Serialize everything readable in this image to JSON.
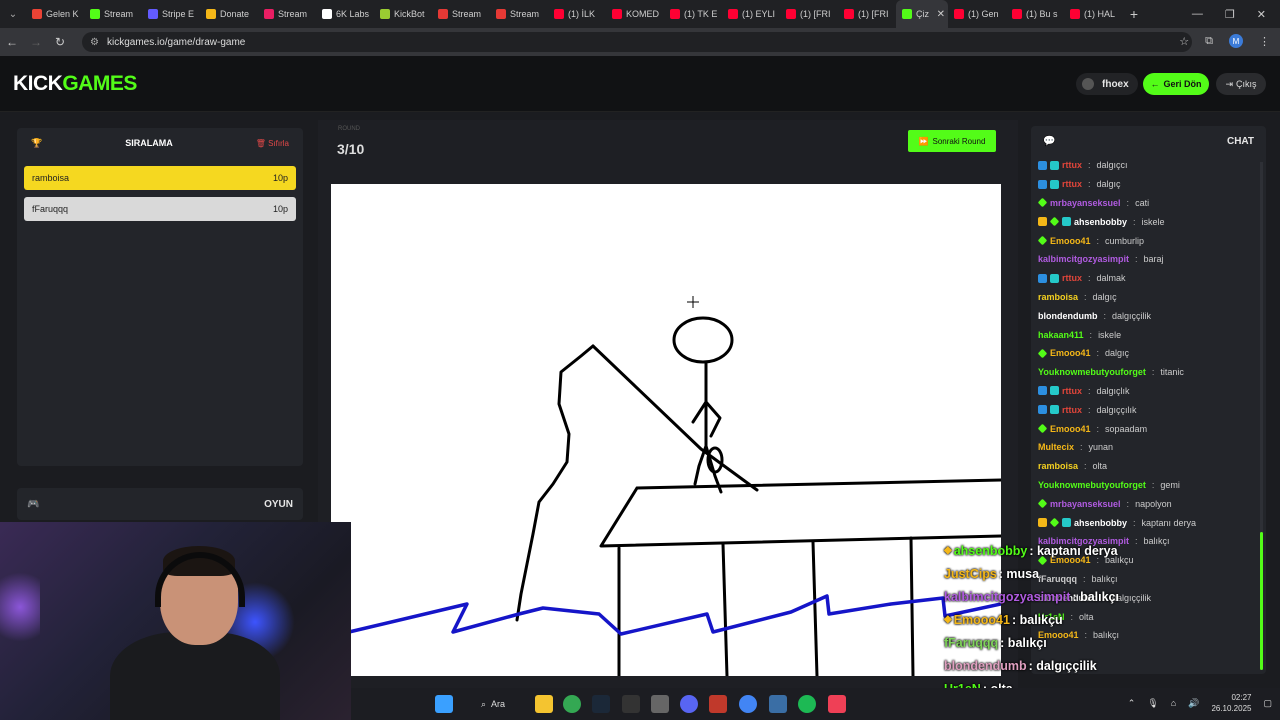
{
  "browser": {
    "tabs": [
      {
        "label": "Gelen K",
        "color": "#ea4335"
      },
      {
        "label": "Stream",
        "color": "#53fc18"
      },
      {
        "label": "Stripe E",
        "color": "#635bff"
      },
      {
        "label": "Donate",
        "color": "#f4b718"
      },
      {
        "label": "Stream",
        "color": "#e91e63"
      },
      {
        "label": "6K Labs",
        "color": "#ffffff"
      },
      {
        "label": "KickBot",
        "color": "#9acd32"
      },
      {
        "label": "Stream",
        "color": "#e53935"
      },
      {
        "label": "Stream",
        "color": "#e53935"
      },
      {
        "label": "(1) İLK",
        "color": "#ff0033"
      },
      {
        "label": "KOMED",
        "color": "#ff0033"
      },
      {
        "label": "(1) TK E",
        "color": "#ff0033"
      },
      {
        "label": "(1) EYLI",
        "color": "#ff0033"
      },
      {
        "label": "(1) [FRI",
        "color": "#ff0033"
      },
      {
        "label": "(1) [FRI",
        "color": "#ff0033"
      },
      {
        "label": "Çiz",
        "color": "#53fc18",
        "active": true
      },
      {
        "label": "(1) Gen",
        "color": "#ff0033"
      },
      {
        "label": "(1) Bu s",
        "color": "#ff0033"
      },
      {
        "label": "(1) HAL",
        "color": "#ff0033"
      }
    ],
    "url": "kickgames.io/game/draw-game",
    "profile_initial": "M"
  },
  "header": {
    "logo_part1": "KICK",
    "logo_part2": "GAMES",
    "username": "fhoex",
    "back_label": "Geri Dön",
    "exit_label": "Çıkış"
  },
  "leaderboard": {
    "title": "SIRALAMA",
    "reset_label": "Sıfırla",
    "rows": [
      {
        "name": "ramboisa",
        "points": "10p",
        "color": "#f5d820"
      },
      {
        "name": "fFaruqqq",
        "points": "10p",
        "color": "#d9d9d9"
      }
    ]
  },
  "game_panel": {
    "title": "OYUN"
  },
  "round": {
    "label": "ROUND",
    "value": "3/10",
    "next_label": "Sonraki Round"
  },
  "chat": {
    "title": "CHAT",
    "messages": [
      {
        "user": "rttux",
        "color": "#e0453a",
        "badges": [
          "blue",
          "teal"
        ],
        "text": "dalgıçcı"
      },
      {
        "user": "rttux",
        "color": "#e0453a",
        "badges": [
          "blue",
          "teal"
        ],
        "text": "dalgıç"
      },
      {
        "user": "mrbayanseksuel",
        "color": "#b05be0",
        "badges": [
          "green"
        ],
        "text": "cati"
      },
      {
        "user": "ahsenbobby",
        "color": "#ffffff",
        "badges": [
          "gold",
          "green",
          "teal"
        ],
        "text": "iskele"
      },
      {
        "user": "Emooo41",
        "color": "#f4b718",
        "badges": [
          "green"
        ],
        "text": "cumburlip"
      },
      {
        "user": "kalbimcitgozyasimpit",
        "color": "#b05be0",
        "badges": [],
        "text": "baraj"
      },
      {
        "user": "rttux",
        "color": "#e0453a",
        "badges": [
          "blue",
          "teal"
        ],
        "text": "dalmak"
      },
      {
        "user": "ramboisa",
        "color": "#f4d020",
        "badges": [],
        "text": "dalgıç"
      },
      {
        "user": "blondendumb",
        "color": "#ffffff",
        "badges": [],
        "text": "dalgıççilik"
      },
      {
        "user": "hakaan411",
        "color": "#53fc18",
        "badges": [],
        "text": "iskele"
      },
      {
        "user": "Emooo41",
        "color": "#f4b718",
        "badges": [
          "green"
        ],
        "text": "dalgıç"
      },
      {
        "user": "Youknowmebutyouforget",
        "color": "#53fc18",
        "badges": [],
        "text": "titanic"
      },
      {
        "user": "rttux",
        "color": "#e0453a",
        "badges": [
          "blue",
          "teal"
        ],
        "text": "dalgıçlık"
      },
      {
        "user": "rttux",
        "color": "#e0453a",
        "badges": [
          "blue",
          "teal"
        ],
        "text": "dalgıççılık"
      },
      {
        "user": "Emooo41",
        "color": "#f4b718",
        "badges": [
          "green"
        ],
        "text": "sopaadam"
      },
      {
        "user": "Multecix",
        "color": "#f4b718",
        "badges": [],
        "text": "yunan"
      },
      {
        "user": "ramboisa",
        "color": "#f4d020",
        "badges": [],
        "text": "olta"
      },
      {
        "user": "Youknowmebutyouforget",
        "color": "#53fc18",
        "badges": [],
        "text": "gemi"
      },
      {
        "user": "mrbayanseksuel",
        "color": "#b05be0",
        "badges": [
          "green"
        ],
        "text": "napolyon"
      },
      {
        "user": "ahsenbobby",
        "color": "#ffffff",
        "badges": [
          "gold",
          "green",
          "teal"
        ],
        "text": "kaptanı derya"
      },
      {
        "user": "kalbimcitgozyasimpit",
        "color": "#b05be0",
        "badges": [],
        "text": "balıkçı"
      },
      {
        "user": "Emooo41",
        "color": "#f4b718",
        "badges": [
          "green"
        ],
        "text": "balıkçu"
      },
      {
        "user": "fFaruqqq",
        "color": "#cccccc",
        "badges": [],
        "text": "balıkçı"
      },
      {
        "user": "blondendumb",
        "color": "#ffffff",
        "badges": [],
        "text": "dalgıççilik"
      },
      {
        "user": "Ur1eN",
        "color": "#53fc18",
        "badges": [],
        "text": "olta"
      },
      {
        "user": "Emooo41",
        "color": "#f4b718",
        "badges": [],
        "text": "balıkçı"
      }
    ]
  },
  "overlay_chat": [
    {
      "user": "ahsenbobby",
      "color": "#53fc18",
      "text": ": kaptanı derya",
      "icons": true
    },
    {
      "user": "JustCips",
      "color": "#f4b718",
      "text": ": musa"
    },
    {
      "user": "kalbimcitgozyasimpit",
      "color": "#b05be0",
      "text": ": balıkçı"
    },
    {
      "user": "Emooo41",
      "color": "#f4b718",
      "text": ": balıkçu",
      "icons": true
    },
    {
      "user": "fFaruqqq",
      "color": "#7fd35a",
      "text": ": balıkçı"
    },
    {
      "user": "blondendumb",
      "color": "#e0a0c0",
      "text": ": dalgıççilik"
    },
    {
      "user": "Ur1eN",
      "color": "#53fc18",
      "text": ": olta"
    }
  ],
  "taskbar": {
    "search_label": "Ara",
    "time": "02:27",
    "date": "26.10.2025"
  }
}
